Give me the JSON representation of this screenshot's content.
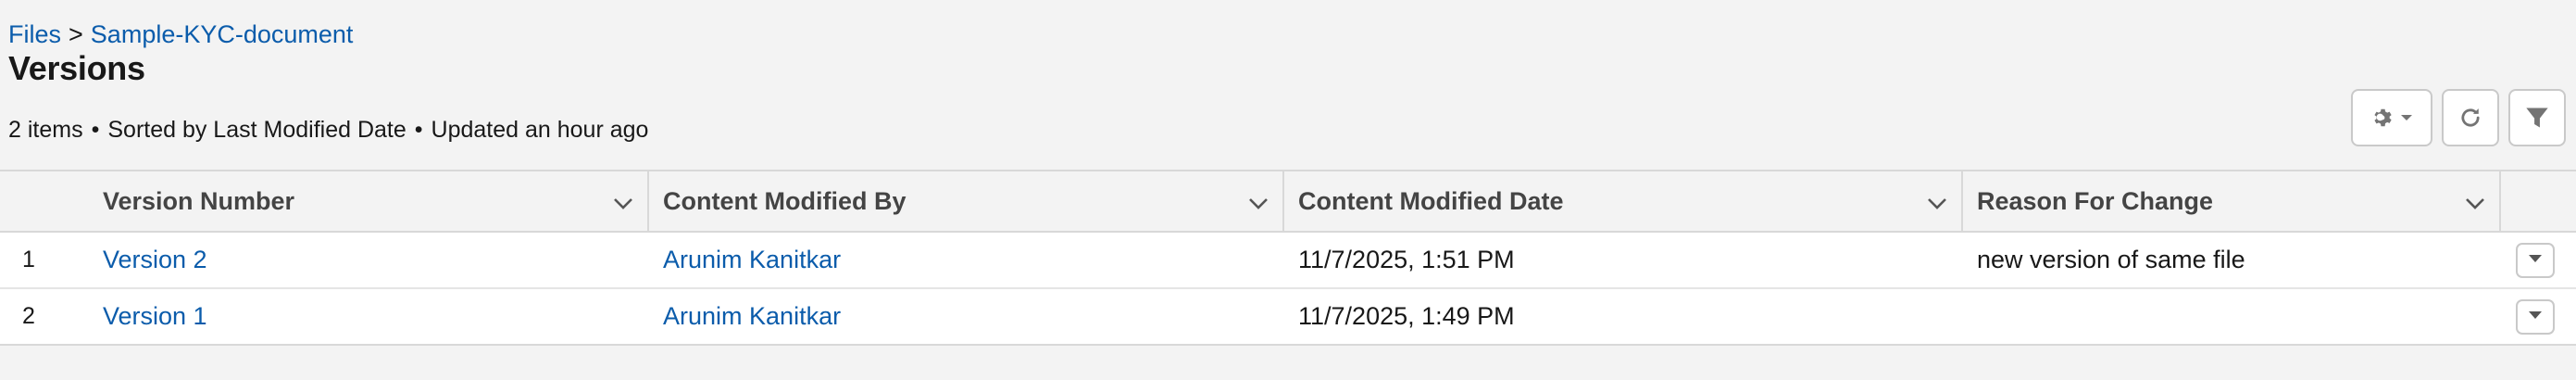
{
  "breadcrumb": {
    "root": "Files",
    "separator": ">",
    "current": "Sample-KYC-document"
  },
  "page_title": "Versions",
  "meta": {
    "item_count": "2 items",
    "sorted_by": "Sorted by Last Modified Date",
    "updated": "Updated an hour ago",
    "separator": "•"
  },
  "toolbar": {
    "settings_icon": "gear-icon",
    "refresh_icon": "refresh-icon",
    "filter_icon": "filter-icon"
  },
  "table": {
    "columns": [
      "Version Number",
      "Content Modified By",
      "Content Modified Date",
      "Reason For Change"
    ],
    "rows": [
      {
        "row_number": "1",
        "version_number": "Version 2",
        "content_modified_by": "Arunim Kanitkar",
        "content_modified_date": "11/7/2025, 1:51 PM",
        "reason_for_change": "new version of same file"
      },
      {
        "row_number": "2",
        "version_number": "Version 1",
        "content_modified_by": "Arunim Kanitkar",
        "content_modified_date": "11/7/2025, 1:49 PM",
        "reason_for_change": ""
      }
    ]
  },
  "colors": {
    "link": "#0b5cab",
    "background": "#f3f3f3",
    "border": "#d8d8d8"
  }
}
